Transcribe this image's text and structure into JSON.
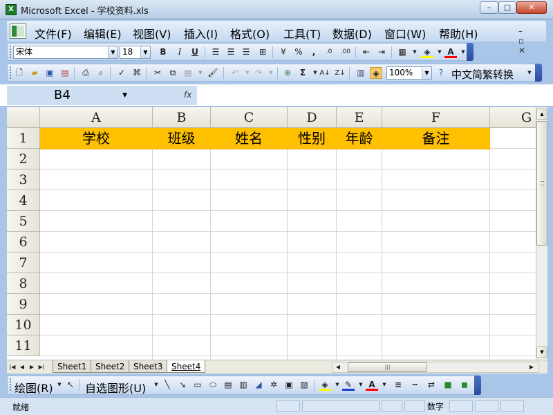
{
  "window": {
    "title": "Microsoft Excel - 学校资料.xls",
    "minimize": "–",
    "maximize": "□",
    "close": "✕"
  },
  "menu": {
    "items": [
      "文件(F)",
      "编辑(E)",
      "视图(V)",
      "插入(I)",
      "格式(O)",
      "工具(T)",
      "数据(D)",
      "窗口(W)",
      "帮助(H)"
    ],
    "doc_controls": "–  ▫  ✕"
  },
  "format_toolbar": {
    "font_name": "宋体",
    "font_size": "18",
    "bold": "B",
    "italic": "I",
    "underline": "U",
    "percent": "%",
    "comma": ",",
    "font_color_letter": "A",
    "highlight_color": "#ffff00",
    "font_color": "#ff0000"
  },
  "standard_toolbar": {
    "sum": "Σ",
    "zoom": "100%",
    "cn_convert": "中文简繁转换"
  },
  "formula_bar": {
    "name_box": "B4",
    "fx_label": "fx",
    "formula": ""
  },
  "sheet": {
    "columns": [
      "A",
      "B",
      "C",
      "D",
      "E",
      "F",
      "G"
    ],
    "rows": [
      "1",
      "2",
      "3",
      "4",
      "5",
      "6",
      "7",
      "8",
      "9",
      "10",
      "11"
    ],
    "header_row": [
      "学校",
      "班级",
      "姓名",
      "性别",
      "年龄",
      "备注"
    ],
    "header_fill": "#ffc000"
  },
  "sheet_tabs": [
    "Sheet1",
    "Sheet2",
    "Sheet3",
    "Sheet4"
  ],
  "active_tab": "Sheet4",
  "drawing_toolbar": {
    "draw_label": "绘图(R)",
    "autoshapes_label": "自选图形(U)"
  },
  "status": {
    "text": "就绪",
    "num_indicator": "数字"
  }
}
